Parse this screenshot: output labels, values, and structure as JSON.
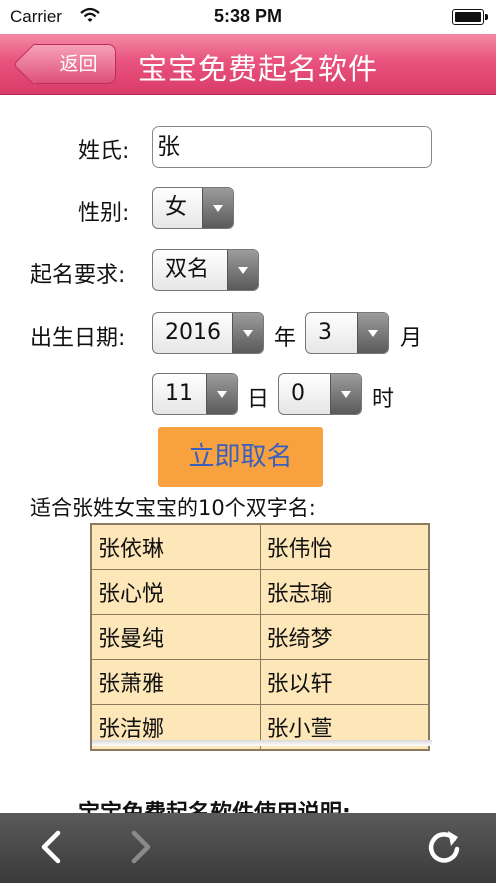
{
  "status_bar": {
    "carrier": "Carrier",
    "time": "5:38 PM"
  },
  "nav": {
    "back_label": "返回",
    "title": "宝宝免费起名软件"
  },
  "form": {
    "surname_label": "姓氏:",
    "surname_value": "张",
    "gender_label": "性别:",
    "gender_value": "女",
    "name_type_label": "起名要求:",
    "name_type_value": "双名",
    "birth_label": "出生日期:",
    "year_value": "2016",
    "year_unit": "年",
    "month_value": "3",
    "month_unit": "月",
    "day_value": "11",
    "day_unit": "日",
    "hour_value": "0",
    "hour_unit": "时"
  },
  "submit_label": "立即取名",
  "result_heading": "适合张姓女宝宝的10个双字名:",
  "names": [
    [
      "张依琳",
      "张伟怡"
    ],
    [
      "张心悦",
      "张志瑜"
    ],
    [
      "张曼纯",
      "张绮梦"
    ],
    [
      "张萧雅",
      "张以轩"
    ],
    [
      "张洁娜",
      "张小萱"
    ]
  ],
  "instructions_title": "宝宝免费起名软件使用说明:",
  "toolbar": {
    "back_icon": "chevron-left-icon",
    "forward_icon": "chevron-right-icon",
    "reload_icon": "reload-icon"
  },
  "colors": {
    "nav_pink": "#e8537c",
    "submit_orange": "#f7a23e",
    "submit_text": "#3a5fbf",
    "table_bg": "#fde6b8",
    "toolbar": "#454545"
  }
}
